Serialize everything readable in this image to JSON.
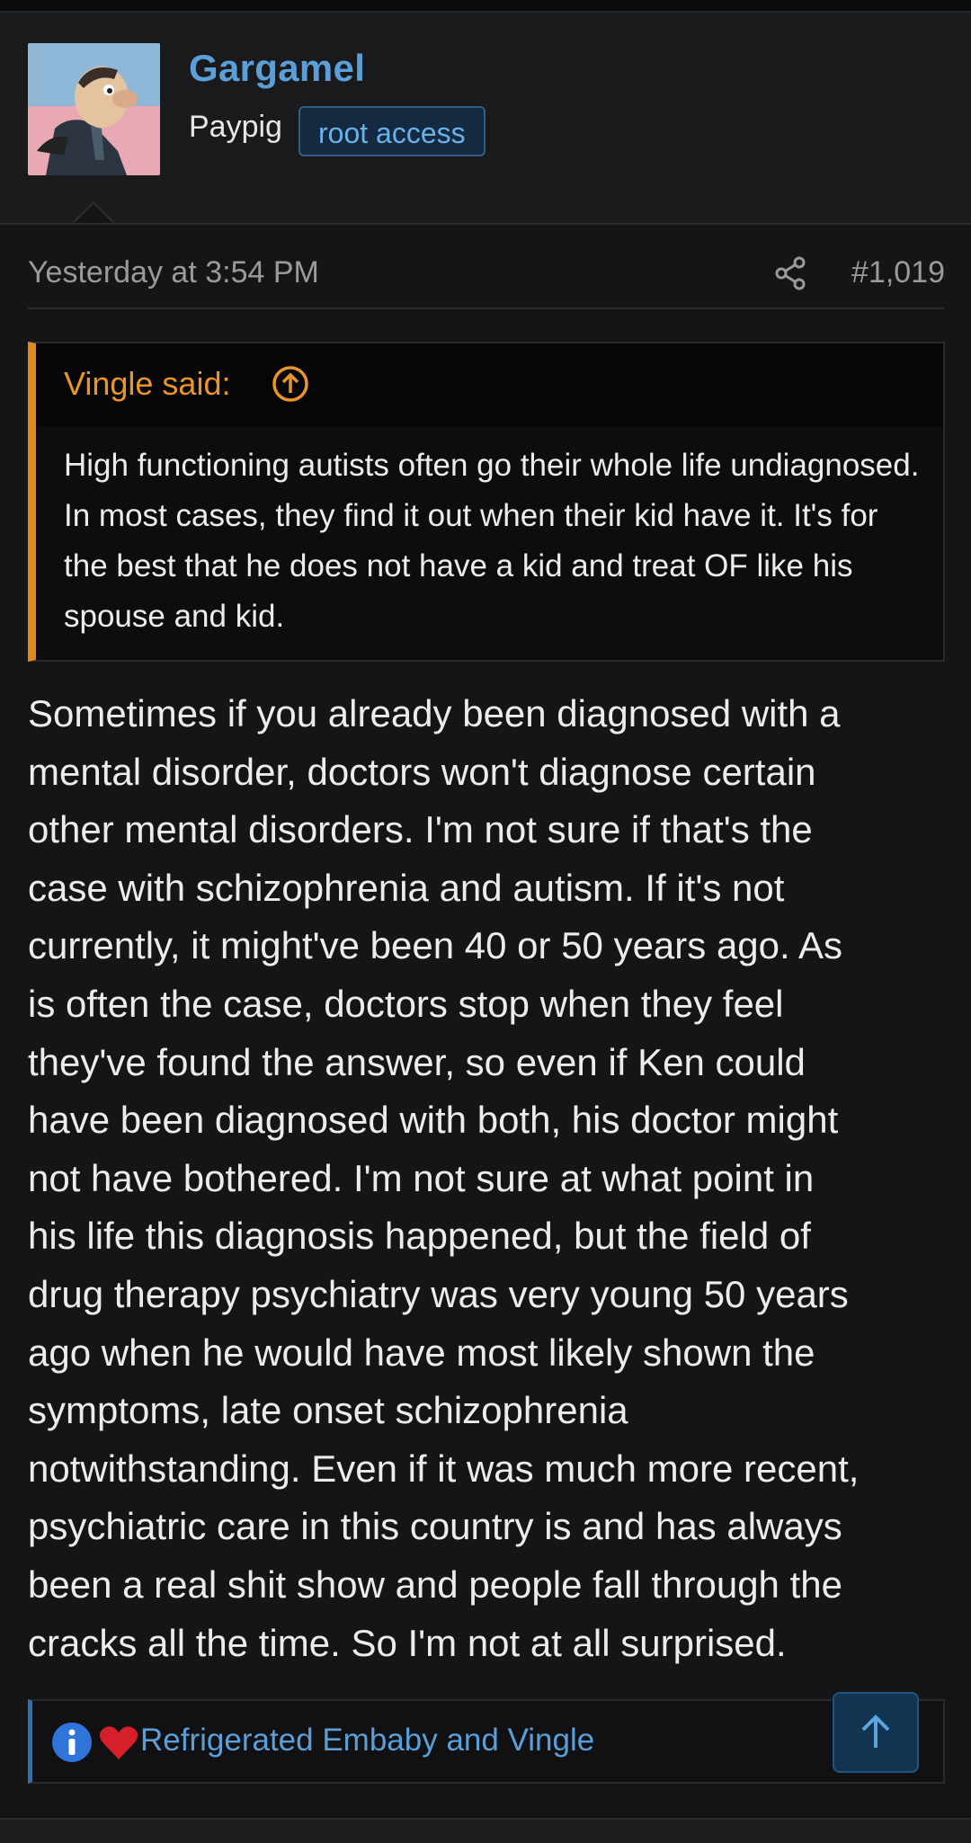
{
  "user": {
    "name": "Gargamel",
    "title": "Paypig",
    "banner": "root access"
  },
  "post": {
    "timestamp": "Yesterday at 3:54 PM",
    "number": "#1,019",
    "quote": {
      "author": "Vingle said:",
      "text": "High functioning autists often go their whole life undiagnosed. In most cases, they find it out when their kid have it. It's for the best that he does not have a kid and treat OF like his spouse and kid."
    },
    "message_lines": [
      "Sometimes if you already been diagnosed with a",
      "mental disorder, doctors won't diagnose certain",
      "other mental disorders. I'm not sure if that's the",
      "case with schizophrenia and autism. If it's not",
      "currently, it might've been 40 or 50 years ago. As",
      "is often the case, doctors stop when they feel",
      "they've found the answer, so even if Ken could",
      "have been diagnosed with both, his doctor might",
      "not have bothered. I'm not sure at what point in",
      "his life this diagnosis happened, but the field of",
      "drug therapy psychiatry was very young 50 years",
      "ago when he would have most likely shown the",
      "symptoms, late onset schizophrenia",
      "notwithstanding. Even if it was much more recent,",
      "psychiatric care in this country is and has always",
      "been a real shit show and people fall through the",
      "cracks all the time. So I'm not at all surprised."
    ],
    "reactions": {
      "text": "Refrigerated Embaby and Vingle",
      "icons": [
        "info-icon",
        "heart-icon"
      ]
    }
  },
  "colors": {
    "accent_link": "#5a9fd8",
    "quote_accent": "#e8952a",
    "background": "#151517"
  }
}
